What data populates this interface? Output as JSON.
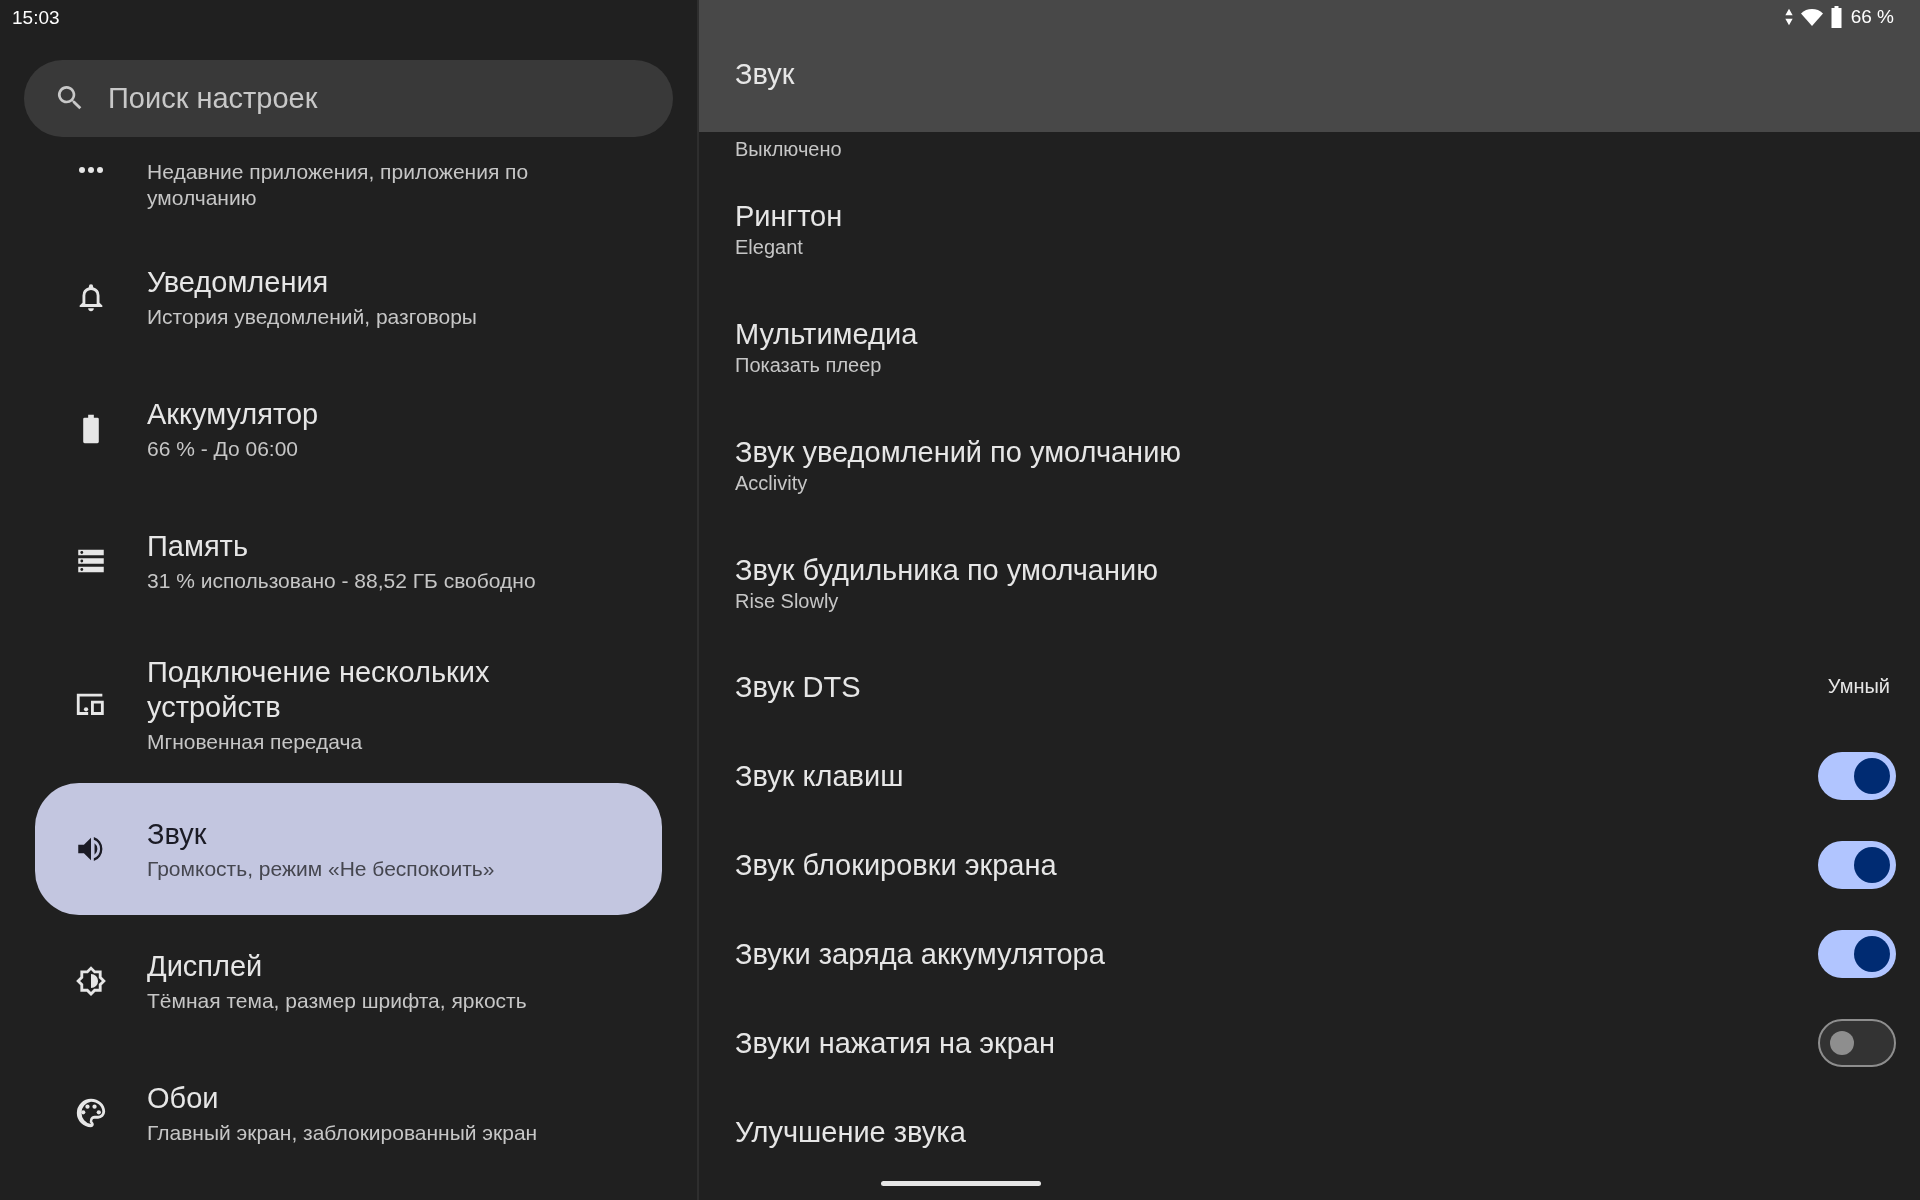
{
  "status_bar": {
    "time": "15:03",
    "battery": "66 %"
  },
  "search": {
    "placeholder": "Поиск настроек"
  },
  "sidebar": {
    "items": [
      {
        "subtitle": "Недавние приложения, приложения по умолчанию",
        "selected": false
      },
      {
        "title": "Уведомления",
        "subtitle": "История уведомлений, разговоры",
        "selected": false
      },
      {
        "title": "Аккумулятор",
        "subtitle": "66 % - До 06:00",
        "selected": false
      },
      {
        "title": "Память",
        "subtitle": "31 % использовано - 88,52 ГБ свободно",
        "selected": false
      },
      {
        "title": "Подключение нескольких устройств",
        "subtitle": "Мгновенная передача",
        "selected": false
      },
      {
        "title": "Звук",
        "subtitle": "Громкость, режим «Не беспокоить»",
        "selected": true
      },
      {
        "title": "Дисплей",
        "subtitle": "Тёмная тема, размер шрифта, яркость",
        "selected": false
      },
      {
        "title": "Обои",
        "subtitle": "Главный экран, заблокированный экран",
        "selected": false
      }
    ]
  },
  "panel": {
    "title": "Звук",
    "rows": [
      {
        "kind": "text",
        "subtitle": "Выключено"
      },
      {
        "kind": "text",
        "title": "Рингтон",
        "subtitle": "Elegant"
      },
      {
        "kind": "text",
        "title": "Мультимедиа",
        "subtitle": "Показать плеер"
      },
      {
        "kind": "text",
        "title": "Звук уведомлений по умолчанию",
        "subtitle": "Acclivity"
      },
      {
        "kind": "text",
        "title": "Звук будильника по умолчанию",
        "subtitle": "Rise Slowly"
      },
      {
        "kind": "value",
        "title": "Звук DTS",
        "value": "Умный"
      },
      {
        "kind": "toggle",
        "title": "Звук клавиш",
        "on": true
      },
      {
        "kind": "toggle",
        "title": "Звук блокировки экрана",
        "on": true
      },
      {
        "kind": "toggle",
        "title": "Звуки заряда аккумулятора",
        "on": true
      },
      {
        "kind": "toggle",
        "title": "Звуки нажатия на экран",
        "on": false
      },
      {
        "kind": "text",
        "title": "Улучшение звука"
      }
    ]
  }
}
